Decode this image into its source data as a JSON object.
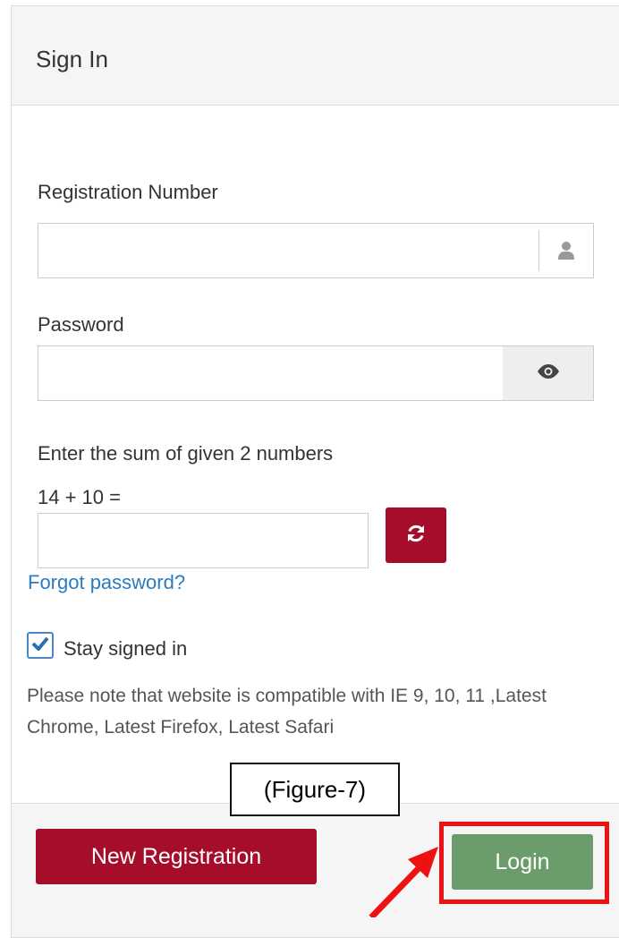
{
  "panel": {
    "title": "Sign In"
  },
  "registration": {
    "label": "Registration Number",
    "value": "",
    "icon": "user-icon"
  },
  "password": {
    "label": "Password",
    "value": "",
    "icon": "eye-icon"
  },
  "captcha": {
    "label": "Enter the sum of given 2 numbers",
    "equation": "14 + 10 =",
    "value": "",
    "refresh_icon": "refresh-icon"
  },
  "forgot_link": "Forgot password?",
  "stay_signed_in": {
    "label": "Stay signed in",
    "checked": true
  },
  "note": "Please note that website is compatible with IE 9, 10, 11 ,Latest Chrome, Latest Firefox, Latest Safari",
  "footer": {
    "new_registration": "New Registration",
    "login": "Login"
  },
  "annotation": {
    "caption": "(Figure-7)",
    "highlight_color": "#ee1111"
  },
  "colors": {
    "primary": "#a50d2b",
    "success": "#6a9d6b",
    "link": "#2a7bbf",
    "check": "#4a86c5"
  }
}
